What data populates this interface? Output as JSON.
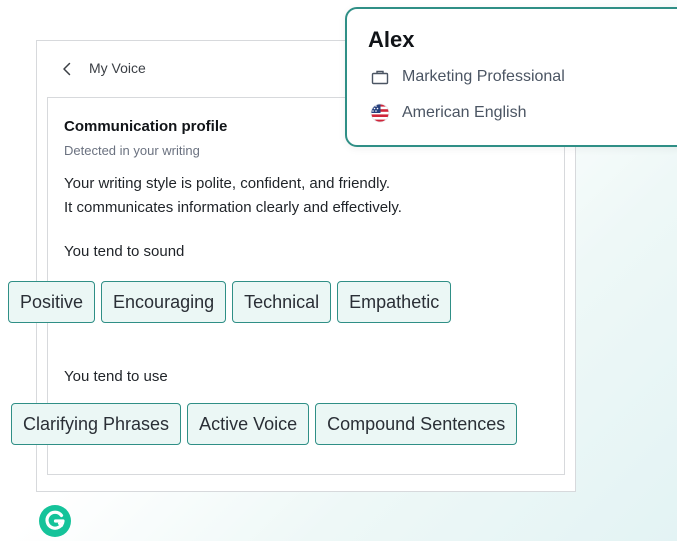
{
  "header": {
    "title": "My Voice"
  },
  "profile_section": {
    "title": "Communication profile",
    "subtitle": "Detected in your writing",
    "description_lines": [
      "Your writing style is polite, confident, and friendly.",
      "It communicates information clearly and effectively."
    ],
    "sound_label": "You tend to sound",
    "sound_chips": [
      "Positive",
      "Encouraging",
      "Technical",
      "Empathetic"
    ],
    "use_label": "You tend to use",
    "use_chips": [
      "Clarifying Phrases",
      "Active Voice",
      "Compound Sentences"
    ]
  },
  "user_card": {
    "name": "Alex",
    "role": "Marketing Professional",
    "language": "American English",
    "role_icon": "briefcase-icon",
    "language_icon": "us-flag-icon"
  },
  "logo": {
    "name": "grammarly-logo",
    "color": "#15c39a"
  },
  "colors": {
    "accent": "#2f8f86",
    "chip_background": "#ebf7f5"
  }
}
